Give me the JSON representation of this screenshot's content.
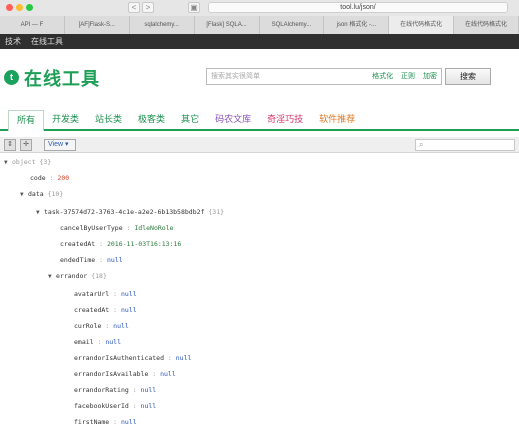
{
  "browser": {
    "url": "tool.lu/json/",
    "tabs": [
      "API — F",
      "[AF]Flask-S...",
      "sqlalchemy...",
      "[Flask] SQLA...",
      "SQLAlchemy...",
      "json 格式化 -...",
      "在线代码格式化",
      "在线代码格式化"
    ],
    "back_label": "<",
    "forward_label": ">"
  },
  "topbar": {
    "items": [
      "技术",
      "在线工具"
    ]
  },
  "header": {
    "logo_letter": "t",
    "title": "在线工具",
    "search_placeholder": "搜索其实很简单",
    "quick_links": [
      "格式化",
      "正则",
      "加密"
    ],
    "search_button": "搜索"
  },
  "nav": {
    "tabs": [
      "所有",
      "开发类",
      "站长类",
      "极客类",
      "其它",
      "码农文库",
      "奇淫巧技",
      "软件推荐"
    ]
  },
  "json_toolbar": {
    "view_label": "View ▾",
    "search_icon": "⌕"
  },
  "tree": {
    "rows": [
      {
        "key": "object",
        "count": "{3}",
        "type": "root"
      },
      {
        "key": "code",
        "value": "200",
        "vtype": "num"
      },
      {
        "key": "data",
        "count": "{10}",
        "type": "obj"
      },
      {
        "key": "task-37574d72-3763-4c1e-a2e2-6b13b58bdb2f",
        "count": "{31}",
        "type": "obj"
      },
      {
        "key": "cancelByUserType",
        "value": "IdleNoRole",
        "vtype": "str2"
      },
      {
        "key": "createdAt",
        "value": "2016-11-03T16:13:16",
        "vtype": "str2"
      },
      {
        "key": "endedTime",
        "value": "null",
        "vtype": "null"
      },
      {
        "key": "errandor",
        "count": "{18}",
        "type": "obj"
      },
      {
        "key": "avatarUrl",
        "value": "null",
        "vtype": "null"
      },
      {
        "key": "createdAt",
        "value": "null",
        "vtype": "null"
      },
      {
        "key": "curRole",
        "value": "null",
        "vtype": "null"
      },
      {
        "key": "email",
        "value": "null",
        "vtype": "null"
      },
      {
        "key": "errandorIsAuthenticated",
        "value": "null",
        "vtype": "null"
      },
      {
        "key": "errandorIsAvailable",
        "value": "null",
        "vtype": "null"
      },
      {
        "key": "errandorRating",
        "value": "null",
        "vtype": "null"
      },
      {
        "key": "facebookUserId",
        "value": "null",
        "vtype": "null"
      },
      {
        "key": "firstName",
        "value": "null",
        "vtype": "null"
      }
    ]
  },
  "colors": {
    "brand": "#1e9e57",
    "null_value": "#2a55b8",
    "number_value": "#d2452a",
    "string_value": "#2a7b3d"
  }
}
